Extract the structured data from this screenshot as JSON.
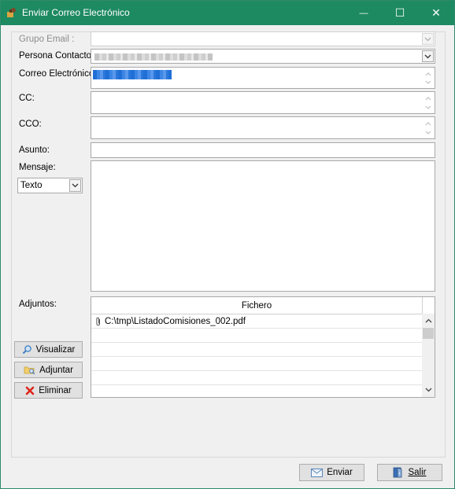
{
  "window": {
    "title": "Enviar Correo Electrónico",
    "minimize": "—",
    "maximize": "☐",
    "close": "✕"
  },
  "form": {
    "grupo_label": "Grupo Email :",
    "persona_label": "Persona Contacto:",
    "correo_label": "Correo Electrónico:",
    "cc_label": "CC:",
    "cco_label": "CCO:",
    "asunto_label": "Asunto:",
    "mensaje_label": "Mensaje:",
    "formato_value": "Texto",
    "adjuntos_label": "Adjuntos:"
  },
  "attachments": {
    "column_header": "Fichero",
    "files": [
      "C:\\tmp\\ListadoComisiones_002.pdf"
    ]
  },
  "buttons": {
    "visualizar": "Visualizar",
    "adjuntar": "Adjuntar",
    "eliminar": "Eliminar",
    "enviar": "Enviar",
    "salir": "Salir"
  },
  "colors": {
    "titlebar": "#1e8a62",
    "selection": "#1f6fd6"
  }
}
